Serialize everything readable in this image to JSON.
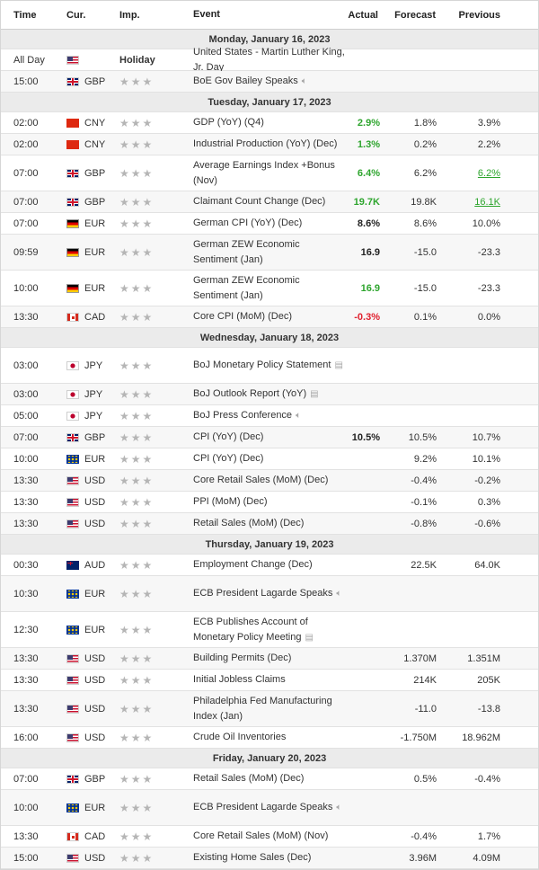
{
  "header": {
    "time": "Time",
    "cur": "Cur.",
    "imp": "Imp.",
    "event": "Event",
    "actual": "Actual",
    "forecast": "Forecast",
    "previous": "Previous"
  },
  "colors": {
    "positive": "#2ea52e",
    "negative": "#e0212f",
    "day_header_bg": "#ebebeb",
    "star_gray": "#b5b5b5"
  },
  "days": [
    {
      "label": "Monday, January 16, 2023",
      "events": [
        {
          "time": "All Day",
          "flag": "us",
          "cur": "",
          "imp": "Holiday",
          "event": "United States - Martin Luther King, Jr. Day",
          "actual": "",
          "forecast": "",
          "previous": ""
        },
        {
          "time": "15:00",
          "flag": "gb",
          "cur": "GBP",
          "imp": "★★★",
          "event": "BoE Gov Bailey Speaks",
          "icon": "speaker-icon",
          "actual": "",
          "forecast": "",
          "previous": ""
        }
      ]
    },
    {
      "label": "Tuesday, January 17, 2023",
      "events": [
        {
          "time": "02:00",
          "flag": "cn",
          "cur": "CNY",
          "imp": "★★★",
          "event": "GDP (YoY) (Q4)",
          "actual": "2.9%",
          "actual_color": "green",
          "forecast": "1.8%",
          "previous": "3.9%"
        },
        {
          "time": "02:00",
          "flag": "cn",
          "cur": "CNY",
          "imp": "★★★",
          "event": "Industrial Production (YoY) (Dec)",
          "actual": "1.3%",
          "actual_color": "green",
          "forecast": "0.2%",
          "previous": "2.2%"
        },
        {
          "time": "07:00",
          "flag": "gb",
          "cur": "GBP",
          "imp": "★★★",
          "event": "Average Earnings Index +Bonus (Nov)",
          "actual": "6.4%",
          "actual_color": "green",
          "forecast": "6.2%",
          "previous": "6.2%",
          "previous_color": "green",
          "tall": true
        },
        {
          "time": "07:00",
          "flag": "gb",
          "cur": "GBP",
          "imp": "★★★",
          "event": "Claimant Count Change (Dec)",
          "actual": "19.7K",
          "actual_color": "green",
          "forecast": "19.8K",
          "previous": "16.1K",
          "previous_color": "green"
        },
        {
          "time": "07:00",
          "flag": "de",
          "cur": "EUR",
          "imp": "★★★",
          "event": "German CPI (YoY) (Dec)",
          "actual": "8.6%",
          "actual_color": "black",
          "forecast": "8.6%",
          "previous": "10.0%"
        },
        {
          "time": "09:59",
          "flag": "de",
          "cur": "EUR",
          "imp": "★★★",
          "event": "German ZEW Economic Sentiment (Jan)",
          "actual": "16.9",
          "actual_color": "black",
          "forecast": "-15.0",
          "previous": "-23.3",
          "tall": true
        },
        {
          "time": "10:00",
          "flag": "de",
          "cur": "EUR",
          "imp": "★★★",
          "event": "German ZEW Economic Sentiment (Jan)",
          "actual": "16.9",
          "actual_color": "green",
          "forecast": "-15.0",
          "previous": "-23.3",
          "tall": true
        },
        {
          "time": "13:30",
          "flag": "ca",
          "cur": "CAD",
          "imp": "★★★",
          "event": "Core CPI (MoM) (Dec)",
          "actual": "-0.3%",
          "actual_color": "red",
          "forecast": "0.1%",
          "previous": "0.0%"
        }
      ]
    },
    {
      "label": "Wednesday, January 18, 2023",
      "events": [
        {
          "time": "03:00",
          "flag": "jp",
          "cur": "JPY",
          "imp": "★★★",
          "event": "BoJ Monetary Policy Statement",
          "icon": "document-icon",
          "actual": "",
          "forecast": "",
          "previous": "",
          "tall": true
        },
        {
          "time": "03:00",
          "flag": "jp",
          "cur": "JPY",
          "imp": "★★★",
          "event": "BoJ Outlook Report (YoY)",
          "icon": "document-icon",
          "actual": "",
          "forecast": "",
          "previous": ""
        },
        {
          "time": "05:00",
          "flag": "jp",
          "cur": "JPY",
          "imp": "★★★",
          "event": "BoJ Press Conference",
          "icon": "speaker-icon",
          "actual": "",
          "forecast": "",
          "previous": ""
        },
        {
          "time": "07:00",
          "flag": "gb",
          "cur": "GBP",
          "imp": "★★★",
          "event": "CPI (YoY) (Dec)",
          "actual": "10.5%",
          "actual_color": "black",
          "forecast": "10.5%",
          "previous": "10.7%"
        },
        {
          "time": "10:00",
          "flag": "eu",
          "cur": "EUR",
          "imp": "★★★",
          "event": "CPI (YoY) (Dec)",
          "actual": "",
          "forecast": "9.2%",
          "previous": "10.1%"
        },
        {
          "time": "13:30",
          "flag": "us",
          "cur": "USD",
          "imp": "★★★",
          "event": "Core Retail Sales (MoM) (Dec)",
          "actual": "",
          "forecast": "-0.4%",
          "previous": "-0.2%"
        },
        {
          "time": "13:30",
          "flag": "us",
          "cur": "USD",
          "imp": "★★★",
          "event": "PPI (MoM) (Dec)",
          "actual": "",
          "forecast": "-0.1%",
          "previous": "0.3%"
        },
        {
          "time": "13:30",
          "flag": "us",
          "cur": "USD",
          "imp": "★★★",
          "event": "Retail Sales (MoM) (Dec)",
          "actual": "",
          "forecast": "-0.8%",
          "previous": "-0.6%"
        }
      ]
    },
    {
      "label": "Thursday, January 19, 2023",
      "events": [
        {
          "time": "00:30",
          "flag": "au",
          "cur": "AUD",
          "imp": "★★★",
          "event": "Employment Change (Dec)",
          "actual": "",
          "forecast": "22.5K",
          "previous": "64.0K"
        },
        {
          "time": "10:30",
          "flag": "eu",
          "cur": "EUR",
          "imp": "★★★",
          "event": "ECB President Lagarde Speaks",
          "icon": "speaker-icon",
          "actual": "",
          "forecast": "",
          "previous": "",
          "tall": true
        },
        {
          "time": "12:30",
          "flag": "eu",
          "cur": "EUR",
          "imp": "★★★",
          "event": "ECB Publishes Account of Monetary Policy Meeting",
          "icon": "document-icon",
          "actual": "",
          "forecast": "",
          "previous": "",
          "tall": true
        },
        {
          "time": "13:30",
          "flag": "us",
          "cur": "USD",
          "imp": "★★★",
          "event": "Building Permits (Dec)",
          "actual": "",
          "forecast": "1.370M",
          "previous": "1.351M"
        },
        {
          "time": "13:30",
          "flag": "us",
          "cur": "USD",
          "imp": "★★★",
          "event": "Initial Jobless Claims",
          "actual": "",
          "forecast": "214K",
          "previous": "205K"
        },
        {
          "time": "13:30",
          "flag": "us",
          "cur": "USD",
          "imp": "★★★",
          "event": "Philadelphia Fed Manufacturing Index (Jan)",
          "actual": "",
          "forecast": "-11.0",
          "previous": "-13.8",
          "tall": true
        },
        {
          "time": "16:00",
          "flag": "us",
          "cur": "USD",
          "imp": "★★★",
          "event": "Crude Oil Inventories",
          "actual": "",
          "forecast": "-1.750M",
          "previous": "18.962M"
        }
      ]
    },
    {
      "label": "Friday, January 20, 2023",
      "events": [
        {
          "time": "07:00",
          "flag": "gb",
          "cur": "GBP",
          "imp": "★★★",
          "event": "Retail Sales (MoM) (Dec)",
          "actual": "",
          "forecast": "0.5%",
          "previous": "-0.4%"
        },
        {
          "time": "10:00",
          "flag": "eu",
          "cur": "EUR",
          "imp": "★★★",
          "event": "ECB President Lagarde Speaks",
          "icon": "speaker-icon",
          "actual": "",
          "forecast": "",
          "previous": "",
          "tall": true
        },
        {
          "time": "13:30",
          "flag": "ca",
          "cur": "CAD",
          "imp": "★★★",
          "event": "Core Retail Sales (MoM) (Nov)",
          "actual": "",
          "forecast": "-0.4%",
          "previous": "1.7%"
        },
        {
          "time": "15:00",
          "flag": "us",
          "cur": "USD",
          "imp": "★★★",
          "event": "Existing Home Sales (Dec)",
          "actual": "",
          "forecast": "3.96M",
          "previous": "4.09M"
        }
      ]
    }
  ]
}
